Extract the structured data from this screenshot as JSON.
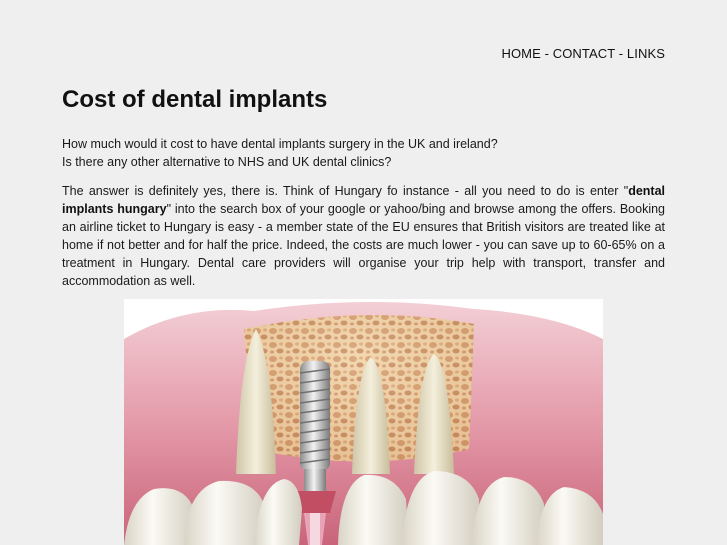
{
  "nav": {
    "home": "HOME",
    "contact": "CONTACT",
    "links": "LINKS",
    "separator": " - "
  },
  "page": {
    "title": "Cost of dental implants"
  },
  "intro": {
    "line1": "How much would it cost to have dental implants surgery in the UK and ireland?",
    "line2": "Is there any other alternative to NHS and UK dental clinics?"
  },
  "body": {
    "part1": "The answer is definitely yes, there is. Think of Hungary fo instance - all you need to do is enter \"",
    "keyword": "dental implants hungary",
    "part2": "\" into the search box of your google or yahoo/bing and browse among the offers. Booking an airline ticket to Hungary is easy - a member state of the EU ensures that British visitors are treated like at home if not better and for half the price. Indeed, the costs are much lower - you can save up to 60-65% on a treatment in Hungary. Dental care providers will organise your trip help with transport, transfer and accommodation as well."
  },
  "colors": {
    "background": "#efefef",
    "gum": "#e7a9b4",
    "bone": "#e8c9a0",
    "tooth": "#f7f4ea",
    "implant": "#b8b8b8"
  }
}
